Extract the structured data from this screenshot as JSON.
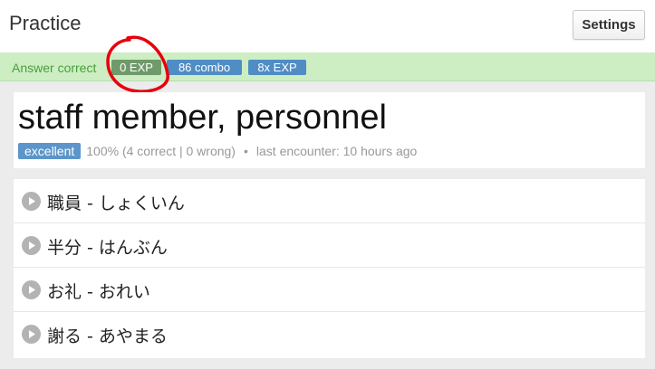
{
  "header": {
    "title": "Practice",
    "settings_label": "Settings"
  },
  "status": {
    "answer_text": "Answer correct",
    "badges": [
      {
        "label": "0 EXP",
        "color": "#6f9a6a"
      },
      {
        "label": "86 combo",
        "color": "#4f8dc4"
      },
      {
        "label": "8x EXP",
        "color": "#4f8dc4"
      }
    ],
    "annotation_color": "#e8000b"
  },
  "word": {
    "meaning": "staff member, personnel",
    "rating": "excellent",
    "stats": "100% (4 correct | 0 wrong)",
    "separator": "•",
    "last_encounter": "last encounter: 10 hours ago"
  },
  "readings": [
    {
      "text": "職員 - しょくいん",
      "icon": "play-icon"
    },
    {
      "text": "半分 - はんぶん",
      "icon": "play-icon"
    },
    {
      "text": "お礼 - おれい",
      "icon": "play-icon"
    },
    {
      "text": "謝る - あやまる",
      "icon": "play-icon"
    }
  ]
}
